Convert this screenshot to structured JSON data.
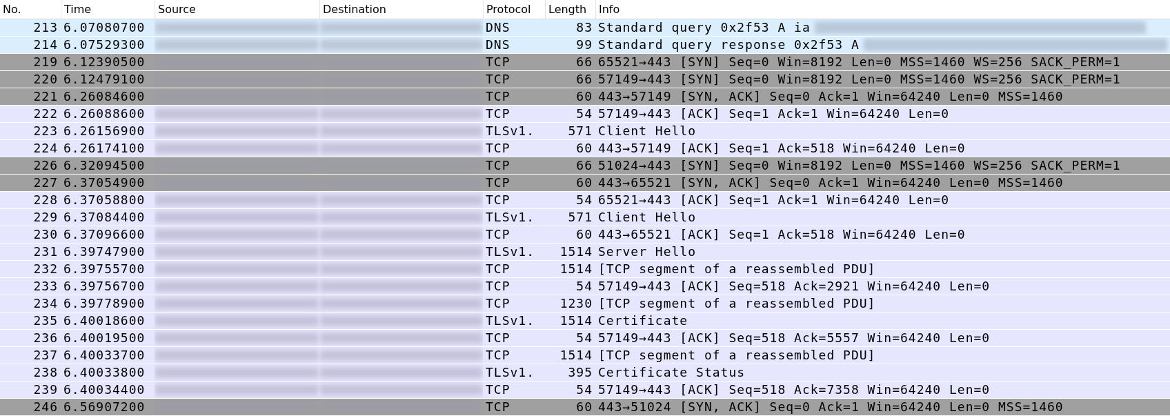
{
  "table": {
    "columns": [
      "No.",
      "Time",
      "Source",
      "Destination",
      "Protocol",
      "Length",
      "Info"
    ],
    "rows": [
      {
        "no": "213",
        "time": "6.07080700",
        "protocol": "DNS",
        "length": "83",
        "info": "Standard query 0x2f53  A ia",
        "info_redacted": true,
        "color": "#daeefe"
      },
      {
        "no": "214",
        "time": "6.07529300",
        "protocol": "DNS",
        "length": "99",
        "info": "Standard query response 0x2f53  A",
        "info_redacted": true,
        "color": "#daeefe"
      },
      {
        "no": "219",
        "time": "6.12390500",
        "protocol": "TCP",
        "length": "66",
        "info": "65521→443 [SYN] Seq=0 Win=8192 Len=0 MSS=1460 WS=256 SACK_PERM=1",
        "info_redacted": false,
        "color": "#a0a0a0"
      },
      {
        "no": "220",
        "time": "6.12479100",
        "protocol": "TCP",
        "length": "66",
        "info": "57149→443 [SYN] Seq=0 Win=8192 Len=0 MSS=1460 WS=256 SACK_PERM=1",
        "info_redacted": false,
        "color": "#a0a0a0"
      },
      {
        "no": "221",
        "time": "6.26084600",
        "protocol": "TCP",
        "length": "60",
        "info": "443→57149 [SYN, ACK] Seq=0 Ack=1 Win=64240 Len=0 MSS=1460",
        "info_redacted": false,
        "color": "#a0a0a0"
      },
      {
        "no": "222",
        "time": "6.26088600",
        "protocol": "TCP",
        "length": "54",
        "info": "57149→443 [ACK] Seq=1 Ack=1 Win=64240 Len=0",
        "info_redacted": false,
        "color": "#e7e6ff"
      },
      {
        "no": "223",
        "time": "6.26156900",
        "protocol": "TLSv1.",
        "length": "571",
        "info": "Client Hello",
        "info_redacted": false,
        "color": "#e7e6ff"
      },
      {
        "no": "224",
        "time": "6.26174100",
        "protocol": "TCP",
        "length": "60",
        "info": "443→57149 [ACK] Seq=1 Ack=518 Win=64240 Len=0",
        "info_redacted": false,
        "color": "#e7e6ff"
      },
      {
        "no": "226",
        "time": "6.32094500",
        "protocol": "TCP",
        "length": "66",
        "info": "51024→443 [SYN] Seq=0 Win=8192 Len=0 MSS=1460 WS=256 SACK_PERM=1",
        "info_redacted": false,
        "color": "#a0a0a0"
      },
      {
        "no": "227",
        "time": "6.37054900",
        "protocol": "TCP",
        "length": "60",
        "info": "443→65521 [SYN, ACK] Seq=0 Ack=1 Win=64240 Len=0 MSS=1460",
        "info_redacted": false,
        "color": "#a0a0a0"
      },
      {
        "no": "228",
        "time": "6.37058800",
        "protocol": "TCP",
        "length": "54",
        "info": "65521→443 [ACK] Seq=1 Ack=1 Win=64240 Len=0",
        "info_redacted": false,
        "color": "#e7e6ff"
      },
      {
        "no": "229",
        "time": "6.37084400",
        "protocol": "TLSv1.",
        "length": "571",
        "info": "Client Hello",
        "info_redacted": false,
        "color": "#e7e6ff"
      },
      {
        "no": "230",
        "time": "6.37096600",
        "protocol": "TCP",
        "length": "60",
        "info": "443→65521 [ACK] Seq=1 Ack=518 Win=64240 Len=0",
        "info_redacted": false,
        "color": "#e7e6ff"
      },
      {
        "no": "231",
        "time": "6.39747900",
        "protocol": "TLSv1.",
        "length": "1514",
        "info": "Server Hello",
        "info_redacted": false,
        "color": "#e7e6ff"
      },
      {
        "no": "232",
        "time": "6.39755700",
        "protocol": "TCP",
        "length": "1514",
        "info": "[TCP segment of a reassembled PDU]",
        "info_redacted": false,
        "color": "#e7e6ff"
      },
      {
        "no": "233",
        "time": "6.39756700",
        "protocol": "TCP",
        "length": "54",
        "info": "57149→443 [ACK] Seq=518 Ack=2921 Win=64240 Len=0",
        "info_redacted": false,
        "color": "#e7e6ff"
      },
      {
        "no": "234",
        "time": "6.39778900",
        "protocol": "TCP",
        "length": "1230",
        "info": "[TCP segment of a reassembled PDU]",
        "info_redacted": false,
        "color": "#e7e6ff"
      },
      {
        "no": "235",
        "time": "6.40018600",
        "protocol": "TLSv1.",
        "length": "1514",
        "info": "Certificate",
        "info_redacted": false,
        "color": "#e7e6ff"
      },
      {
        "no": "236",
        "time": "6.40019500",
        "protocol": "TCP",
        "length": "54",
        "info": "57149→443 [ACK] Seq=518 Ack=5557 Win=64240 Len=0",
        "info_redacted": false,
        "color": "#e7e6ff"
      },
      {
        "no": "237",
        "time": "6.40033700",
        "protocol": "TCP",
        "length": "1514",
        "info": "[TCP segment of a reassembled PDU]",
        "info_redacted": false,
        "color": "#e7e6ff"
      },
      {
        "no": "238",
        "time": "6.40033800",
        "protocol": "TLSv1.",
        "length": "395",
        "info": "Certificate Status",
        "info_redacted": false,
        "color": "#e7e6ff"
      },
      {
        "no": "239",
        "time": "6.40034400",
        "protocol": "TCP",
        "length": "54",
        "info": "57149→443 [ACK] Seq=518 Ack=7358 Win=64240 Len=0",
        "info_redacted": false,
        "color": "#e7e6ff"
      },
      {
        "no": "246",
        "time": "6.56907200",
        "protocol": "TCP",
        "length": "60",
        "info": "443→51024 [SYN, ACK] Seq=0 Ack=1 Win=64240 Len=0 MSS=1460",
        "info_redacted": false,
        "color": "#a0a0a0"
      }
    ]
  }
}
